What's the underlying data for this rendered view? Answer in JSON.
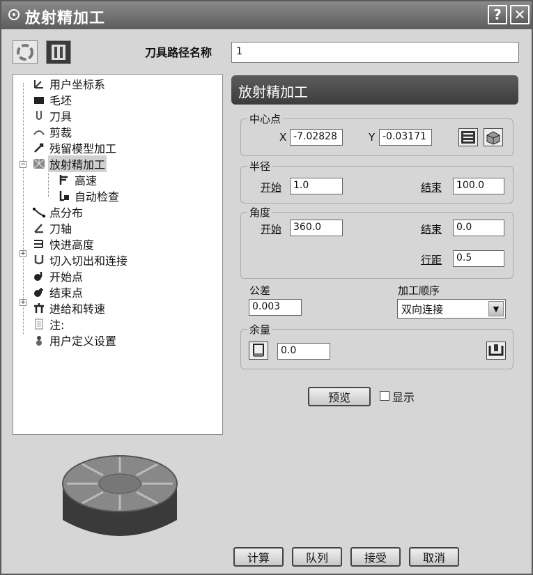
{
  "window": {
    "title": "放射精加工",
    "help_label": "?",
    "close_label": "✕"
  },
  "header": {
    "path_name_label": "刀具路径名称",
    "path_name_value": "1"
  },
  "tree": {
    "items": [
      {
        "label": "用户坐标系",
        "icon": "ucs-icon"
      },
      {
        "label": "毛坯",
        "icon": "block-icon"
      },
      {
        "label": "刀具",
        "icon": "tool-icon"
      },
      {
        "label": "剪裁",
        "icon": "trim-icon"
      },
      {
        "label": "残留模型加工",
        "icon": "rest-model-icon"
      },
      {
        "label": "放射精加工",
        "icon": "radial-finish-icon"
      },
      {
        "label": "高速",
        "icon": "high-speed-icon"
      },
      {
        "label": "自动检查",
        "icon": "auto-check-icon"
      },
      {
        "label": "点分布",
        "icon": "point-distribution-icon"
      },
      {
        "label": "刀轴",
        "icon": "tool-axis-icon"
      },
      {
        "label": "快进高度",
        "icon": "rapid-height-icon"
      },
      {
        "label": "切入切出和连接",
        "icon": "leads-links-icon"
      },
      {
        "label": "开始点",
        "icon": "start-point-icon"
      },
      {
        "label": "结束点",
        "icon": "end-point-icon"
      },
      {
        "label": "进给和转速",
        "icon": "feed-speed-icon"
      },
      {
        "label": "注:",
        "icon": "notes-icon"
      },
      {
        "label": "用户定义设置",
        "icon": "user-settings-icon"
      }
    ]
  },
  "panel": {
    "title": "放射精加工",
    "center": {
      "label": "中心点",
      "x_label": "X",
      "x_value": "-7.02828",
      "y_label": "Y",
      "y_value": "-0.03171"
    },
    "radius": {
      "label": "半径",
      "start_label": "开始",
      "start_value": "1.0",
      "end_label": "结束",
      "end_value": "100.0"
    },
    "angle": {
      "label": "角度",
      "start_label": "开始",
      "start_value": "360.0",
      "end_label": "结束",
      "end_value": "0.0",
      "step_label": "行距",
      "step_value": "0.5"
    },
    "tolerance": {
      "label": "公差",
      "value": "0.003"
    },
    "order": {
      "label": "加工顺序",
      "value": "双向连接"
    },
    "thickness": {
      "label": "余量",
      "value": "0.0"
    },
    "preview_label": "预览",
    "show_label": "显示"
  },
  "footer": {
    "calc_label": "计算",
    "queue_label": "队列",
    "accept_label": "接受",
    "cancel_label": "取消"
  }
}
